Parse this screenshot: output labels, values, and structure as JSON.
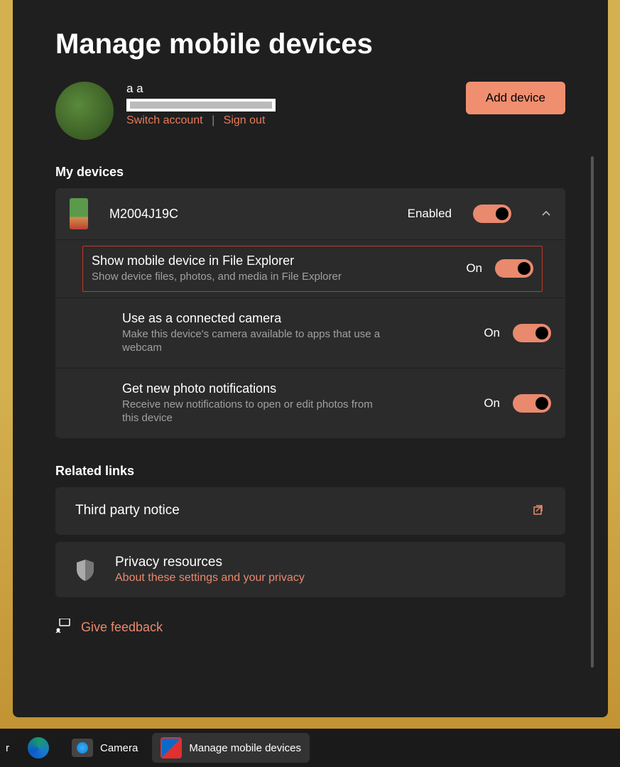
{
  "page": {
    "title": "Manage mobile devices"
  },
  "account": {
    "name": "a a",
    "switch_label": "Switch account",
    "signout_label": "Sign out",
    "add_device_label": "Add device"
  },
  "devices": {
    "section_title": "My devices",
    "items": [
      {
        "name": "M2004J19C",
        "status": "Enabled",
        "settings": [
          {
            "title": "Show mobile device in File Explorer",
            "desc": "Show device files, photos, and media in File Explorer",
            "state": "On",
            "highlighted": true
          },
          {
            "title": "Use as a connected camera",
            "desc": "Make this device's camera available to apps that use a webcam",
            "state": "On",
            "highlighted": false
          },
          {
            "title": "Get new photo notifications",
            "desc": "Receive new notifications to open or edit photos from this device",
            "state": "On",
            "highlighted": false
          }
        ]
      }
    ]
  },
  "related": {
    "section_title": "Related links",
    "third_party_label": "Third party notice",
    "privacy_title": "Privacy resources",
    "privacy_link": "About these settings and your privacy"
  },
  "feedback": {
    "label": "Give feedback"
  },
  "taskbar": {
    "partial": "r",
    "camera_label": "Camera",
    "manage_label": "Manage mobile devices"
  }
}
